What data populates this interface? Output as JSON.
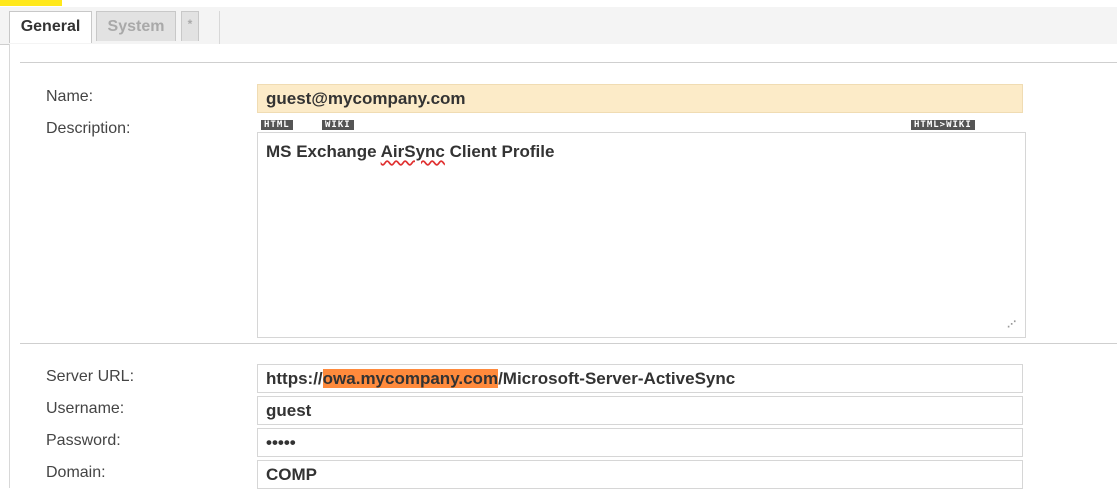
{
  "tabs": [
    {
      "label": "General"
    },
    {
      "label": "System"
    },
    {
      "label": "*"
    }
  ],
  "form": {
    "name_label": "Name:",
    "name_value": "guest@mycompany.com",
    "description_label": "Description:",
    "editor_tool_html": "HTML",
    "editor_tool_wiki": "WIKI",
    "editor_tool_convert": "HTML>WIKI",
    "description_prefix": "MS Exchange ",
    "description_misspelled": "AirSync",
    "description_suffix": " Client Profile",
    "server_url_label": "Server URL:",
    "server_url_prefix": "https://",
    "server_url_host": "owa.mycompany.com",
    "server_url_path": "/Microsoft-Server-ActiveSync",
    "username_label": "Username:",
    "username_value": "guest",
    "password_label": "Password:",
    "password_value": "•••••",
    "domain_label": "Domain:",
    "domain_value": "COMP"
  },
  "colors": {
    "name_field_bg": "#fcebc8",
    "url_highlight": "#ff8a3c",
    "top_highlight": "#ffe81a"
  }
}
